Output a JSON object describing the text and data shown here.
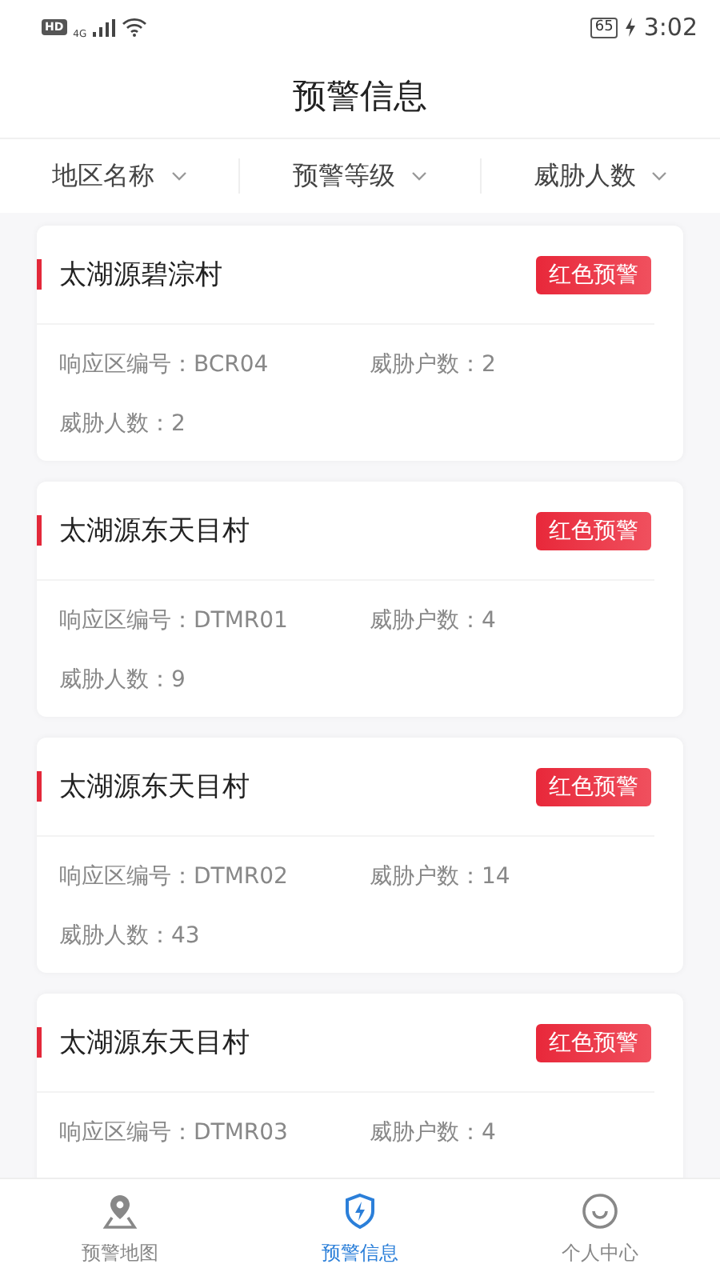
{
  "status_bar": {
    "hd": "HD",
    "network": "4G",
    "battery": "65",
    "time": "3:02"
  },
  "header": {
    "title": "预警信息"
  },
  "filters": [
    {
      "label": "地区名称"
    },
    {
      "label": "预警等级"
    },
    {
      "label": "威胁人数"
    }
  ],
  "cards": [
    {
      "name": "太湖源碧淙村",
      "warning": {
        "label": "红色预警",
        "kind": "red"
      },
      "zone_code": "响应区编号：BCR04",
      "households": "威胁户数：2",
      "people": "威胁人数：2"
    },
    {
      "name": "太湖源东天目村",
      "warning": {
        "label": "红色预警",
        "kind": "red"
      },
      "zone_code": "响应区编号：DTMR01",
      "households": "威胁户数：4",
      "people": "威胁人数：9"
    },
    {
      "name": "太湖源东天目村",
      "warning": {
        "label": "红色预警",
        "kind": "red"
      },
      "zone_code": "响应区编号：DTMR02",
      "households": "威胁户数：14",
      "people": "威胁人数：43"
    },
    {
      "name": "太湖源东天目村",
      "warning": {
        "label": "红色预警",
        "kind": "red"
      },
      "zone_code": "响应区编号：DTMR03",
      "households": "威胁户数：4"
    }
  ],
  "tab_bar": [
    {
      "label": "预警地图",
      "kind": "map",
      "selected": false
    },
    {
      "label": "预警信息",
      "kind": "shield",
      "selected": true
    },
    {
      "label": "个人中心",
      "kind": "smile",
      "selected": false
    }
  ]
}
